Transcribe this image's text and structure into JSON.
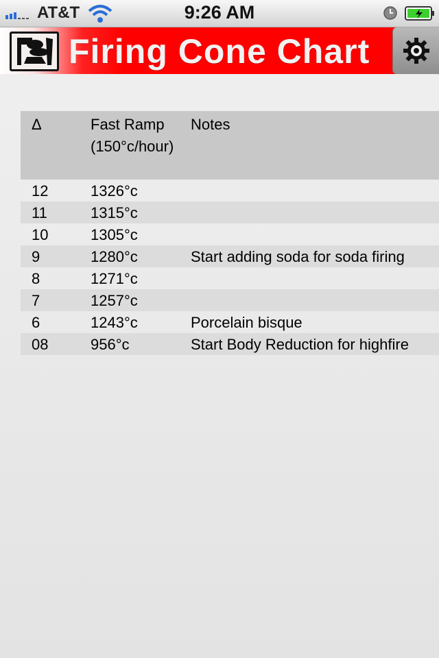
{
  "status_bar": {
    "carrier": "AT&T",
    "time": "9:26 AM"
  },
  "header": {
    "title": "Firing Cone Chart",
    "logo_icon": "kiln-logo-icon",
    "settings_icon": "gear-icon",
    "colors": {
      "title_bar": "#ff0000",
      "title_text": "#f2f2f2"
    }
  },
  "table": {
    "headers": {
      "cone": "Δ",
      "ramp_line1": "Fast Ramp",
      "ramp_line2": "(150°c/hour)",
      "notes": "Notes"
    },
    "rows": [
      {
        "cone": "12",
        "temp": "1326°c",
        "note": ""
      },
      {
        "cone": "11",
        "temp": "1315°c",
        "note": ""
      },
      {
        "cone": "10",
        "temp": "1305°c",
        "note": ""
      },
      {
        "cone": "9",
        "temp": "1280°c",
        "note": "Start adding soda for soda firing"
      },
      {
        "cone": "8",
        "temp": "1271°c",
        "note": ""
      },
      {
        "cone": "7",
        "temp": "1257°c",
        "note": ""
      },
      {
        "cone": "6",
        "temp": "1243°c",
        "note": "Porcelain bisque"
      },
      {
        "cone": "08",
        "temp": "956°c",
        "note": "Start Body Reduction for highfire"
      }
    ]
  }
}
